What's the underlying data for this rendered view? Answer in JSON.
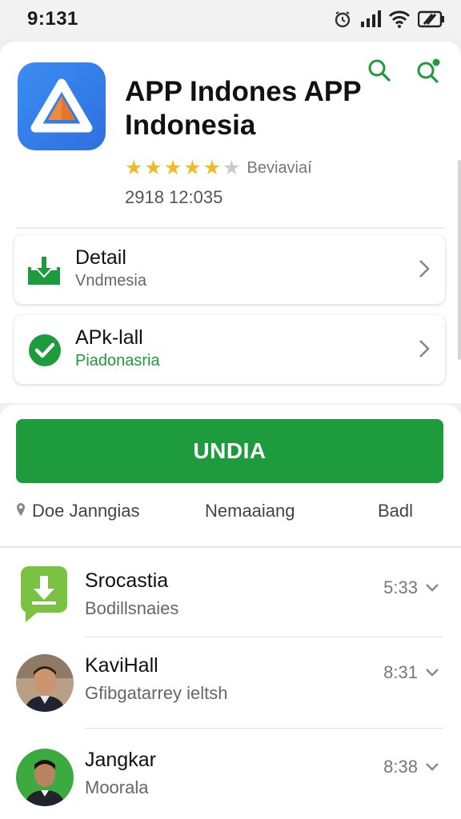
{
  "status": {
    "time": "9:131"
  },
  "app": {
    "title": "APP Indones APP Indonesia",
    "rating_stars": 4,
    "rating_text": "Beviaviaí",
    "date": "2918 12:035"
  },
  "cards": [
    {
      "title": "Detail",
      "subtitle": "Vndmesia",
      "icon": "download-icon"
    },
    {
      "title": "APk-lall",
      "subtitle": "Piadonasria",
      "icon": "check-circle-icon"
    }
  ],
  "install": {
    "label": "UNDIA"
  },
  "tabs": [
    {
      "label": "Doe Janngias",
      "icon": "location-pin-icon"
    },
    {
      "label": "Nemaaiang"
    },
    {
      "label": "Badl"
    }
  ],
  "list": [
    {
      "name": "Srocastia",
      "sub": "Bodillsnaies",
      "time": "5:33"
    },
    {
      "name": "KaviHall",
      "sub": "Gfibgatarrey ieltsh",
      "time": "8:31"
    },
    {
      "name": "Jangkar",
      "sub": "Moorala",
      "time": "8:38"
    }
  ],
  "colors": {
    "accent_green": "#1e9b3c",
    "app_blue": "#3b8df3",
    "star": "#f2b928"
  }
}
